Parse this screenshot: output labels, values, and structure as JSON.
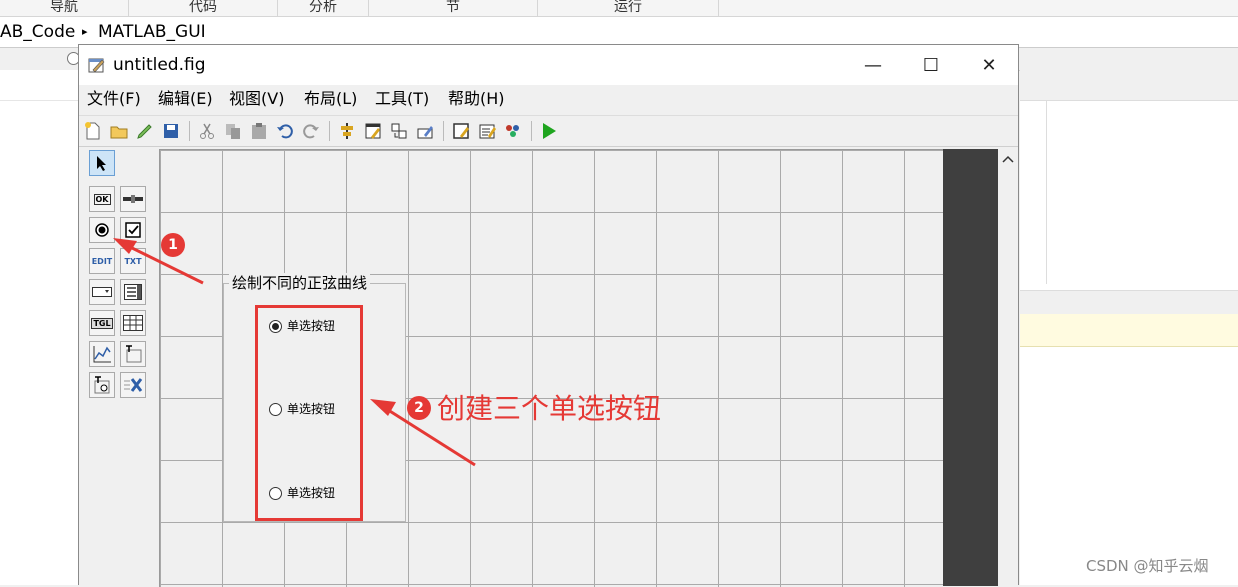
{
  "ribbon": {
    "tabs": [
      "导航",
      "代码",
      "分析",
      "节",
      "运行"
    ]
  },
  "path": {
    "segment1": "AB_Code",
    "separator": "▸",
    "segment2": "MATLAB_GUI"
  },
  "window": {
    "title": "untitled.fig",
    "controls": {
      "minimize": "—",
      "maximize": "☐",
      "close": "✕"
    }
  },
  "menubar": {
    "items": [
      "文件(F)",
      "编辑(E)",
      "视图(V)",
      "布局(L)",
      "工具(T)",
      "帮助(H)"
    ]
  },
  "palette": {
    "labels": {
      "push_button": "OK",
      "edit_text": "EDIT",
      "static_text": "TXT",
      "toggle_button": "TGL"
    }
  },
  "button_group": {
    "title": "绘制不同的正弦曲线"
  },
  "radios": [
    {
      "label": "单选按钮",
      "selected": true
    },
    {
      "label": "单选按钮",
      "selected": false
    },
    {
      "label": "单选按钮",
      "selected": false
    }
  ],
  "annotations": {
    "badge1": "1",
    "badge2": "2",
    "text2": "创建三个单选按钮",
    "color": "#e53935"
  },
  "watermark": "CSDN @知乎云烟"
}
